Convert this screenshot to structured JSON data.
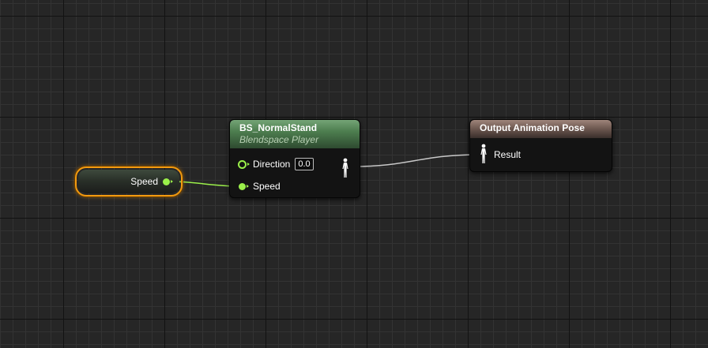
{
  "graph": {
    "background_color": "#262626",
    "wire_colors": {
      "float": "#9bf04a",
      "pose": "#c8c8c8"
    }
  },
  "variable_node": {
    "label": "Speed",
    "selection_color": "#f19a10",
    "pin_color": "#9bf04a"
  },
  "blendspace_node": {
    "title": "BS_NormalStand",
    "subtitle": "Blendspace Player",
    "header_color": "#5f8f61",
    "inputs": [
      {
        "label": "Direction",
        "default_value": "0.0",
        "connected": false
      },
      {
        "label": "Speed",
        "connected": true
      }
    ],
    "output_pin": {
      "icon": "pose-icon"
    }
  },
  "output_node": {
    "title": "Output Animation Pose",
    "header_color": "#8a7066",
    "inputs": [
      {
        "label": "Result",
        "icon": "pose-icon"
      }
    ]
  }
}
